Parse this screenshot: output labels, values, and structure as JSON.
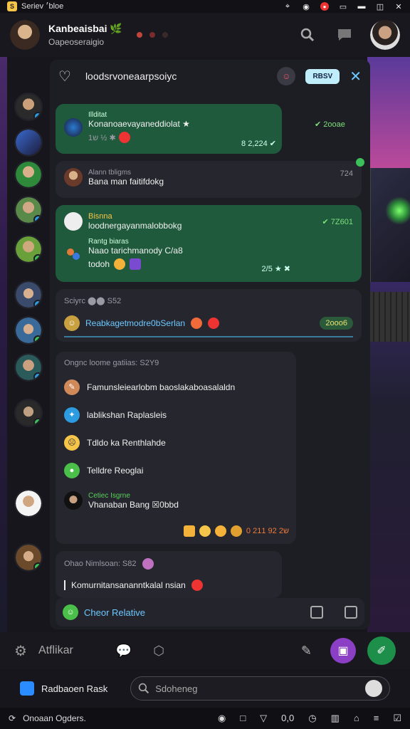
{
  "status_bar": {
    "app_label": "Seriev ׳bloe",
    "icons": [
      "location-icon",
      "wifi-icon",
      "notification-icon",
      "battery-icon",
      "flag-icon",
      "window-icon",
      "close-icon"
    ]
  },
  "header": {
    "title": "Kanbeaisbai 🌿",
    "subtitle": "Oapeoseraigio"
  },
  "panel": {
    "title": "loodsrvoneaarpsoiyc",
    "chip": "RBSV",
    "close": "✕"
  },
  "messages": [
    {
      "label": "Illditat",
      "text": "Konanoaevayaneddiolat ★",
      "meta": "1ש ½ ✱",
      "time": "✔ 2ooae",
      "stamp": "8 2,224 ✔"
    },
    {
      "label": "Alann tbligms",
      "text": "Bana man faitifdokg",
      "time": "724"
    },
    {
      "label": "Bisnna",
      "text": "loodnergayanmalobbokg",
      "time": "✔ 7Z601",
      "label2": "Rantg biaras",
      "text2": "Naao tarichmanody C/a8",
      "text3": "todoh",
      "stamp": "2/5 ★ ✖"
    },
    {
      "label": "Sciyrc ⬤⬤ S52",
      "text": "Reabkagetmodre0bSerlan",
      "time": "2ooo6"
    }
  ],
  "list_card": {
    "heading": "Ongnc loome gatiias: S2Y9",
    "items": [
      {
        "text": "Famunsleiearlobm baoslakaboasalaldn"
      },
      {
        "text": "lablikshan Raplasleis"
      },
      {
        "text": "Tdldo ka Renthlahde"
      },
      {
        "text": "Telldre Reoglai"
      }
    ],
    "sub_label": "Cetiec Isgrne",
    "sub_text": "Vhanaban Bang ☒0bbd",
    "stamp": "0 2ש2 92 11"
  },
  "last_card": {
    "heading": "Ohao Nimlsoan: S82",
    "text": "Komurnitansananntkalal nsian"
  },
  "panel_footer": {
    "label": "Cheor Relative"
  },
  "action_bar": {
    "name": "Atflikar"
  },
  "compose": {
    "brand": "Radbaoen Rask",
    "search_placeholder": "Sdoheneg"
  },
  "nav": {
    "label": "Onoaan Ogders.",
    "zoom": "0,0"
  },
  "colors": {
    "accent_blue": "#6cc8ff",
    "accent_green": "#1f5a3c",
    "fab_purple": "#8b3fc4",
    "fab_green": "#1e8f4a"
  }
}
